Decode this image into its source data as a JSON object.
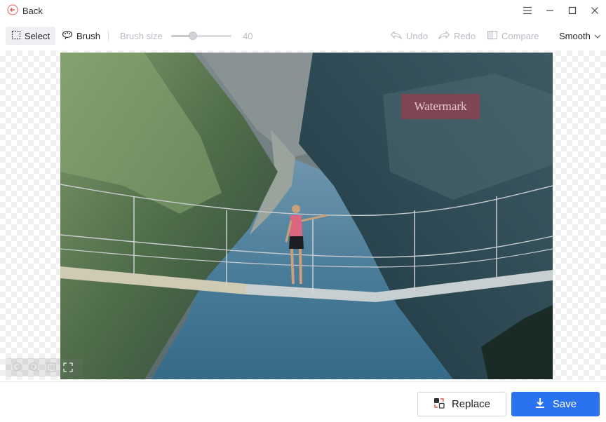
{
  "titlebar": {
    "back_label": "Back"
  },
  "toolbar": {
    "select_label": "Select",
    "brush_label": "Brush",
    "brush_size_label": "Brush size",
    "brush_size_value": "40",
    "undo_label": "Undo",
    "redo_label": "Redo",
    "compare_label": "Compare",
    "mode_label": "Smooth"
  },
  "canvas": {
    "watermark_text": "Watermark"
  },
  "actions": {
    "replace_label": "Replace",
    "save_label": "Save"
  },
  "colors": {
    "accent": "#2b72f0",
    "watermark": "#b43246"
  }
}
